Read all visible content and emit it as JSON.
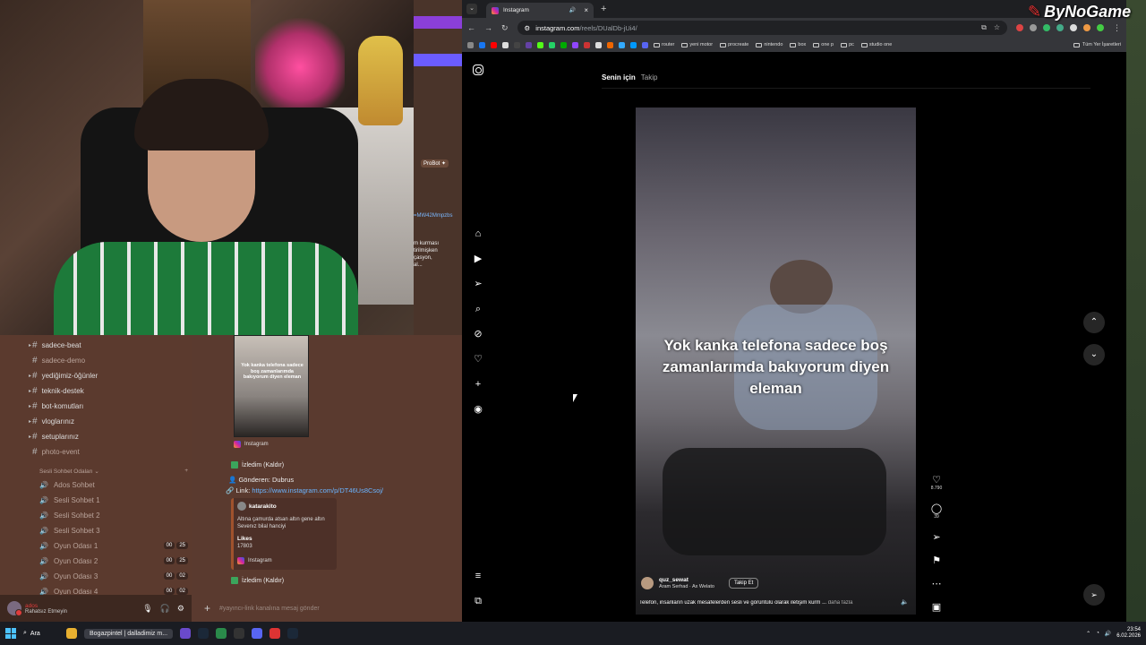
{
  "watermark": "ByNoGame",
  "discord": {
    "side_tag": "ProBot ✦",
    "side_link": "=MW42Mmpzbs",
    "side_text": "m kurması\ntirilmişken\nçasyon,\nal...",
    "channels": [
      {
        "name": "sadece-beat",
        "muted": false
      },
      {
        "name": "sadece-demo",
        "muted": true
      },
      {
        "name": "yediğimiz-öğünler",
        "muted": false
      },
      {
        "name": "teknik-destek",
        "muted": false
      },
      {
        "name": "bot-komutları",
        "muted": false
      },
      {
        "name": "vloglarınız",
        "muted": false
      },
      {
        "name": "setuplarınız",
        "muted": false
      },
      {
        "name": "photo-event",
        "muted": true
      }
    ],
    "voice_header": "Sesli Sohbet Odaları ⌄",
    "voice": [
      {
        "name": "Ados Sohbet",
        "a": "",
        "b": ""
      },
      {
        "name": "Sesli Sohbet 1",
        "a": "",
        "b": ""
      },
      {
        "name": "Sesli Sohbet 2",
        "a": "",
        "b": ""
      },
      {
        "name": "Sesli Sohbet 3",
        "a": "",
        "b": ""
      },
      {
        "name": "Oyun Odası 1",
        "a": "00",
        "b": "25"
      },
      {
        "name": "Oyun Odası 2",
        "a": "00",
        "b": "25"
      },
      {
        "name": "Oyun Odası 3",
        "a": "00",
        "b": "02"
      },
      {
        "name": "Oyun Odası 4",
        "a": "00",
        "b": "02"
      }
    ],
    "thumb_text": "Yok kanka telefona sadece boş zamanlarımda bakıyorum diyen eleman",
    "instagram_label": "Instagram",
    "watched": "İzledim (Kaldır)",
    "sender": "Gönderen: Dubrus",
    "link_label": "Link:",
    "link_url": "https://www.instagram.com/p/DT46Us8Csoj/",
    "embed": {
      "author": "katarakito",
      "desc": "Altına çamurda atsan altın gene altın\nSevenız bilal hanciyi",
      "likes_label": "Likes",
      "likes_value": "17803",
      "source": "Instagram"
    },
    "user": {
      "name": "ados",
      "status": "Rahatsız Etmeyin"
    },
    "message_placeholder": "#yayıncı-link kanalına mesaj gönder"
  },
  "browser": {
    "tab_title": "Instagram",
    "url_host": "instagram.com",
    "url_path": "/reels/DUalDb-jUi4/",
    "bookmarks": [
      "router",
      "yeni motor",
      "procreate",
      "nintendo",
      "box",
      "one p",
      "pc",
      "studio one"
    ],
    "all_bookmarks": "Tüm Yer İşaretleri"
  },
  "instagram": {
    "tab_for_you": "Senin için",
    "tab_following": "Takip",
    "caption": "Yok kanka telefona sadece boş zamanlarımda bakıyorum diyen eleman",
    "username": "quz_sewat",
    "music": "Aram Serhad · Ax Welato",
    "follow": "Takip Et",
    "description": "Telefon, insanların uzak mesafelerden sesli ve görüntülü olarak iletişim kurm ...",
    "more": "daha fazla",
    "likes": "8.790",
    "comments": "39"
  },
  "taskbar": {
    "search": "Ara",
    "active_window": "Bogazpintel | dalladimiz m...",
    "time": "23:54",
    "date": "6.02.2026"
  },
  "colors": {
    "accent": "#0095f6",
    "discord_bg": "#5b3a2e",
    "ig_bg": "#000000",
    "brand_red": "#e03030"
  }
}
